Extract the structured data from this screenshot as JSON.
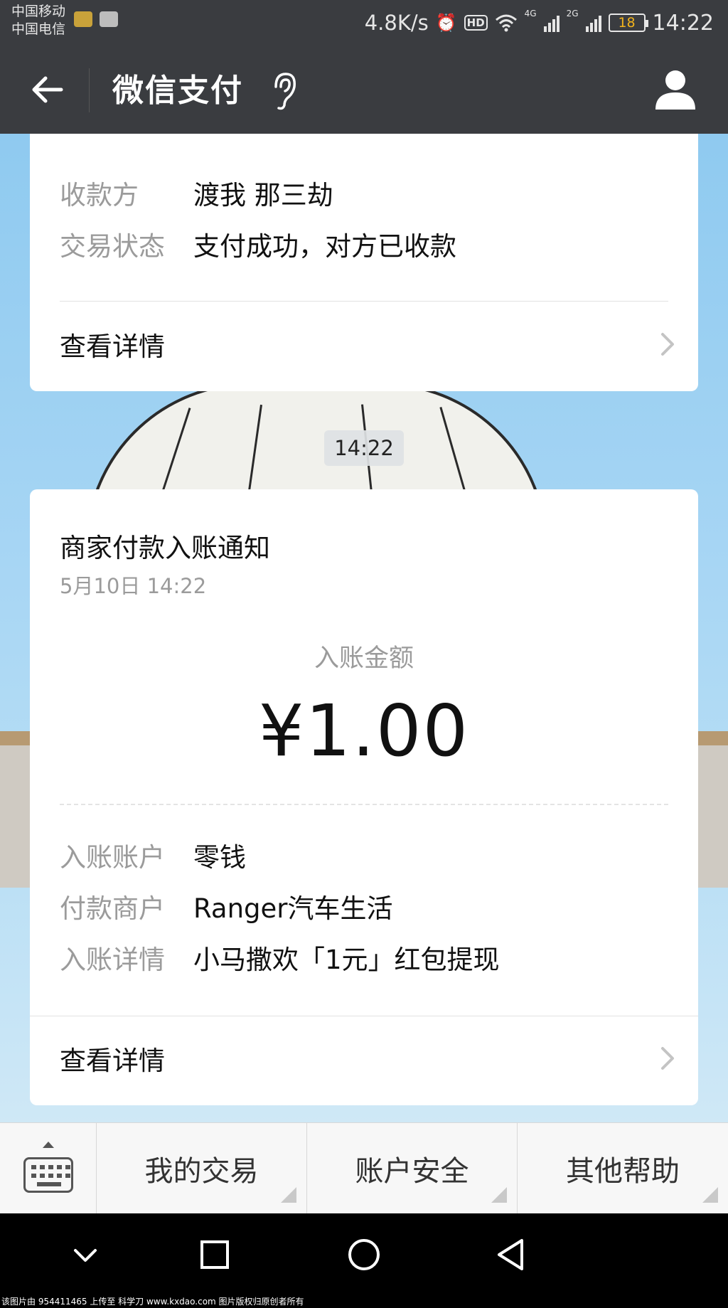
{
  "status_bar": {
    "carrier_1": "中国移动",
    "carrier_2": "中国电信",
    "network_speed": "4.8K/s",
    "hd_label": "HD",
    "signal_1_label": "4G",
    "signal_2_label": "2G",
    "battery_level": "18",
    "time": "14:22",
    "icons": [
      "alarm-icon",
      "hd-icon",
      "wifi-icon",
      "signal-icon",
      "battery-icon"
    ]
  },
  "header": {
    "title": "微信支付",
    "icons": [
      "back-arrow-icon",
      "ear-icon",
      "user-profile-icon"
    ]
  },
  "card_previous": {
    "rows": [
      {
        "label": "收款方",
        "value": "渡我  那三劫"
      },
      {
        "label": "交易状态",
        "value": "支付成功，对方已收款"
      }
    ],
    "detail_link": "查看详情"
  },
  "timestamp": "14:22",
  "card_notice": {
    "title": "商家付款入账通知",
    "date": "5月10日  14:22",
    "amount_label": "入账金额",
    "amount": "¥1.00",
    "rows": [
      {
        "label": "入账账户",
        "value": "零钱"
      },
      {
        "label": "付款商户",
        "value": "Ranger汽车生活"
      },
      {
        "label": "入账详情",
        "value": "小马撒欢「1元」红包提现"
      }
    ],
    "detail_link": "查看详情"
  },
  "menu": {
    "items": [
      {
        "label": "我的交易"
      },
      {
        "label": "账户安全"
      },
      {
        "label": "其他帮助"
      }
    ],
    "icons": [
      "keyboard-icon"
    ]
  },
  "nav": {
    "icons": [
      "collapse-chevron-icon",
      "recent-apps-icon",
      "home-icon",
      "back-triangle-icon"
    ]
  },
  "footer_text": "该图片由 954411465 上传至 科学刀 www.kxdao.com 图片版权归原创者所有",
  "colors": {
    "header_bg": "#3a3c40",
    "battery_text": "#f2b31c",
    "label_gray": "#9b9b9b"
  }
}
